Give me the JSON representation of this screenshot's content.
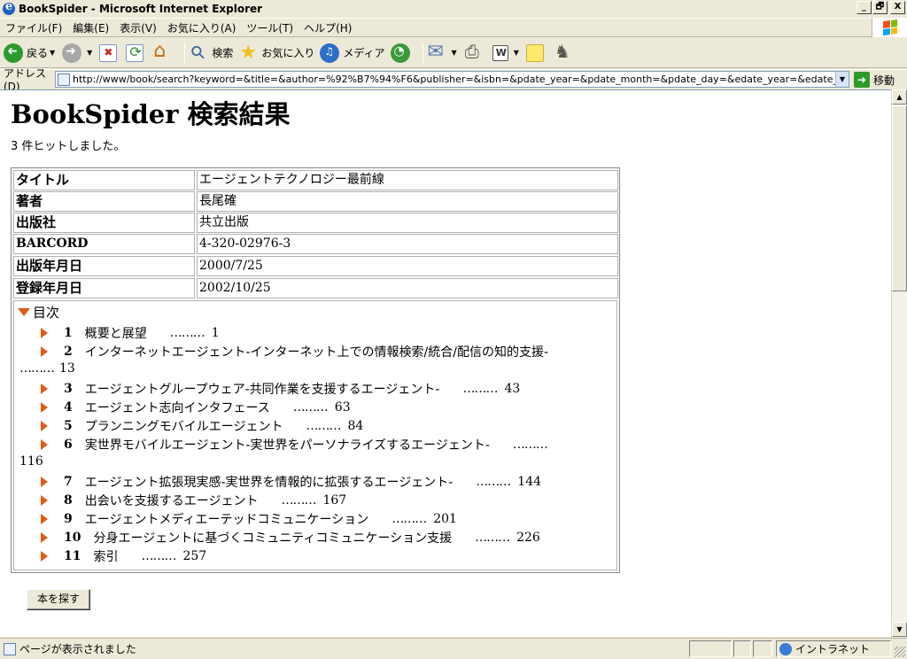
{
  "window": {
    "title": "BookSpider - Microsoft Internet Explorer",
    "minimize": "_",
    "maximize": "🗗",
    "close": "X"
  },
  "menu": [
    "ファイル(F)",
    "編集(E)",
    "表示(V)",
    "お気に入り(A)",
    "ツール(T)",
    "ヘルプ(H)"
  ],
  "toolbar": {
    "back": "戻る",
    "search": "検索",
    "favorites": "お気に入り",
    "media": "メディア"
  },
  "address": {
    "label": "アドレス(D)",
    "url": "http://www/book/search?keyword=&title=&author=%92%B7%94%F6&publisher=&isbn=&pdate_year=&pdate_month=&pdate_day=&edate_year=&edate_month=&edate_day",
    "go": "移動"
  },
  "page": {
    "title": "BookSpider 検索結果",
    "hits": "3 件ヒットしました。",
    "fields": [
      {
        "key": "タイトル",
        "value": "エージェントテクノロジー最前線"
      },
      {
        "key": "著者",
        "value": "長尾確"
      },
      {
        "key": "出版社",
        "value": "共立出版"
      },
      {
        "key": "BARCORD",
        "value": "4-320-02976-3"
      },
      {
        "key": "出版年月日",
        "value": "2000/7/25"
      },
      {
        "key": "登録年月日",
        "value": "2002/10/25"
      }
    ],
    "toc_label": "目次",
    "toc": [
      {
        "num": "1",
        "title": "概要と展望",
        "dots": "………",
        "page": "1"
      },
      {
        "num": "2",
        "title": "インターネットエージェント-インターネット上での情報検索/統合/配信の知的支援-",
        "dots": "………",
        "page": "13"
      },
      {
        "num": "3",
        "title": "エージェントグループウェア-共同作業を支援するエージェント-",
        "dots": "………",
        "page": "43"
      },
      {
        "num": "4",
        "title": "エージェント志向インタフェース",
        "dots": "………",
        "page": "63"
      },
      {
        "num": "5",
        "title": "プランニングモバイルエージェント",
        "dots": "………",
        "page": "84"
      },
      {
        "num": "6",
        "title": "実世界モバイルエージェント-実世界をパーソナライズするエージェント-",
        "dots": "………",
        "page": "116"
      },
      {
        "num": "7",
        "title": "エージェント拡張現実感-実世界を情報的に拡張するエージェント-",
        "dots": "………",
        "page": "144"
      },
      {
        "num": "8",
        "title": "出会いを支援するエージェント",
        "dots": "………",
        "page": "167"
      },
      {
        "num": "9",
        "title": "エージェントメディエーテッドコミュニケーション",
        "dots": "………",
        "page": "201"
      },
      {
        "num": "10",
        "title": "分身エージェントに基づくコミュニティコミュニケーション支援",
        "dots": "………",
        "page": "226"
      },
      {
        "num": "11",
        "title": "索引",
        "dots": "………",
        "page": "257"
      }
    ],
    "find_button": "本を探す"
  },
  "status": {
    "text": "ページが表示されました",
    "zone": "イントラネット"
  }
}
